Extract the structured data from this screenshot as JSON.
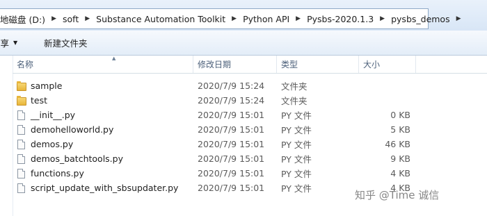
{
  "breadcrumb": [
    {
      "label": "地磁盘 (D:)"
    },
    {
      "label": "soft"
    },
    {
      "label": "Substance Automation Toolkit"
    },
    {
      "label": "Python API"
    },
    {
      "label": "Pysbs-2020.1.3"
    },
    {
      "label": "pysbs_demos"
    }
  ],
  "toolbar": {
    "share_label": "共享",
    "new_folder_label": "新建文件夹"
  },
  "columns": {
    "name": "名称",
    "date": "修改日期",
    "type": "类型",
    "size": "大小"
  },
  "files": [
    {
      "name": "sample",
      "date": "2020/7/9 15:24",
      "type": "文件夹",
      "size": "",
      "icon": "folder-icon"
    },
    {
      "name": "test",
      "date": "2020/7/9 15:24",
      "type": "文件夹",
      "size": "",
      "icon": "folder-icon"
    },
    {
      "name": "__init__.py",
      "date": "2020/7/9 15:01",
      "type": "PY 文件",
      "size": "0 KB",
      "icon": "file-icon"
    },
    {
      "name": "demohelloworld.py",
      "date": "2020/7/9 15:01",
      "type": "PY 文件",
      "size": "5 KB",
      "icon": "file-icon"
    },
    {
      "name": "demos.py",
      "date": "2020/7/9 15:01",
      "type": "PY 文件",
      "size": "46 KB",
      "icon": "file-icon"
    },
    {
      "name": "demos_batchtools.py",
      "date": "2020/7/9 15:01",
      "type": "PY 文件",
      "size": "9 KB",
      "icon": "file-icon"
    },
    {
      "name": "functions.py",
      "date": "2020/7/9 15:01",
      "type": "PY 文件",
      "size": "4 KB",
      "icon": "file-icon"
    },
    {
      "name": "script_update_with_sbsupdater.py",
      "date": "2020/7/9 15:01",
      "type": "PY 文件",
      "size": "4 KB",
      "icon": "file-icon"
    }
  ],
  "watermark": "知乎 @Time 诚信"
}
